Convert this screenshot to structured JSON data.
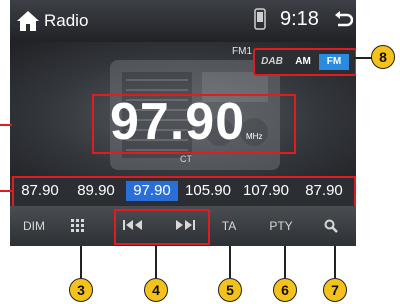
{
  "status_bar": {
    "title": "Radio",
    "time": "9:18"
  },
  "band": {
    "label": "FM1",
    "options": [
      "DAB",
      "AM",
      "FM"
    ],
    "selected": "FM"
  },
  "frequency": {
    "value": "97.90",
    "unit": "MHz",
    "rds": "CT"
  },
  "presets": [
    {
      "label": "87.90",
      "active": false
    },
    {
      "label": "89.90",
      "active": false
    },
    {
      "label": "97.90",
      "active": true
    },
    {
      "label": "105.90",
      "active": false
    },
    {
      "label": "107.90",
      "active": false
    },
    {
      "label": "87.90",
      "active": false
    }
  ],
  "bottom_bar": {
    "dim": "DIM",
    "ta": "TA",
    "pty": "PTY"
  },
  "callouts": [
    "3",
    "4",
    "5",
    "6",
    "7",
    "8"
  ],
  "colors": {
    "highlight": "#e01b22",
    "active": "#2a6fd8",
    "callout": "#f5c21b"
  }
}
